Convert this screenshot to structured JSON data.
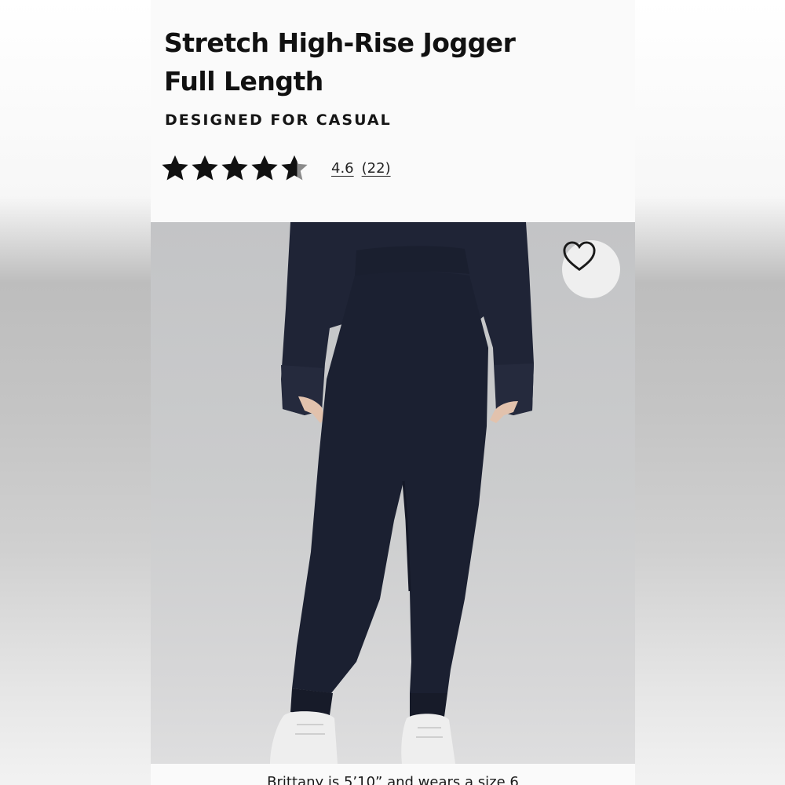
{
  "product": {
    "title_line1": "Stretch High-Rise Jogger",
    "title_line2": "Full Length",
    "designed_for": "DESIGNED FOR CASUAL",
    "rating": "4.6",
    "review_count": "(22)",
    "stars_filled": 4.6,
    "image_icon": "product-photo-navy-jogger",
    "favorite_icon": "heart-outline-icon",
    "model_caption": "Brittany is 5’10” and wears a size 6"
  },
  "colors": {
    "star": "#111111",
    "star_empty": "#8a8a8a",
    "jogger_navy": "#1b2031",
    "sweater_navy": "#1f2436"
  }
}
